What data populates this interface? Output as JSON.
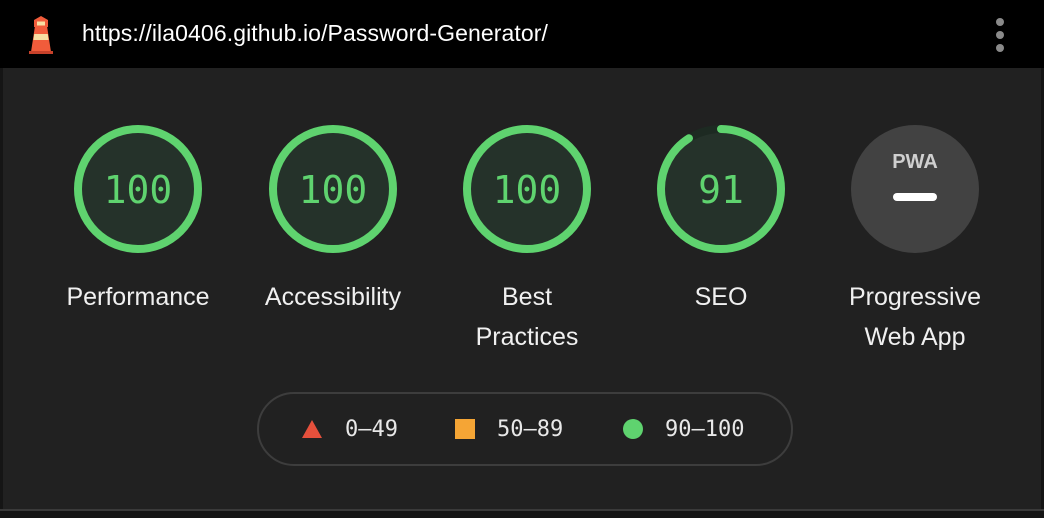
{
  "topbar": {
    "url": "https://ila0406.github.io/Password-Generator/",
    "logo_icon": "lighthouse-icon",
    "menu_icon": "kebab-menu-icon"
  },
  "gauges": [
    {
      "score": "100",
      "label_lines": [
        "Performance"
      ],
      "value": 100
    },
    {
      "score": "100",
      "label_lines": [
        "Accessibility"
      ],
      "value": 100
    },
    {
      "score": "100",
      "label_lines": [
        "Best",
        "Practices"
      ],
      "value": 100
    },
    {
      "score": "91",
      "label_lines": [
        "SEO"
      ],
      "value": 91
    }
  ],
  "pwa": {
    "badge_text": "PWA",
    "label_lines": [
      "Progressive",
      "Web App"
    ]
  },
  "legend": [
    {
      "range": "0–49",
      "shape": "triangle",
      "color": "#e5503c"
    },
    {
      "range": "50–89",
      "shape": "square",
      "color": "#f5a535"
    },
    {
      "range": "90–100",
      "shape": "circle",
      "color": "#5fd36f"
    }
  ],
  "colors": {
    "pass": "#5fd36f",
    "pass_fill": "#25322a",
    "topbar": "#000000",
    "panel": "#212121",
    "pwa_bg": "#424242"
  }
}
